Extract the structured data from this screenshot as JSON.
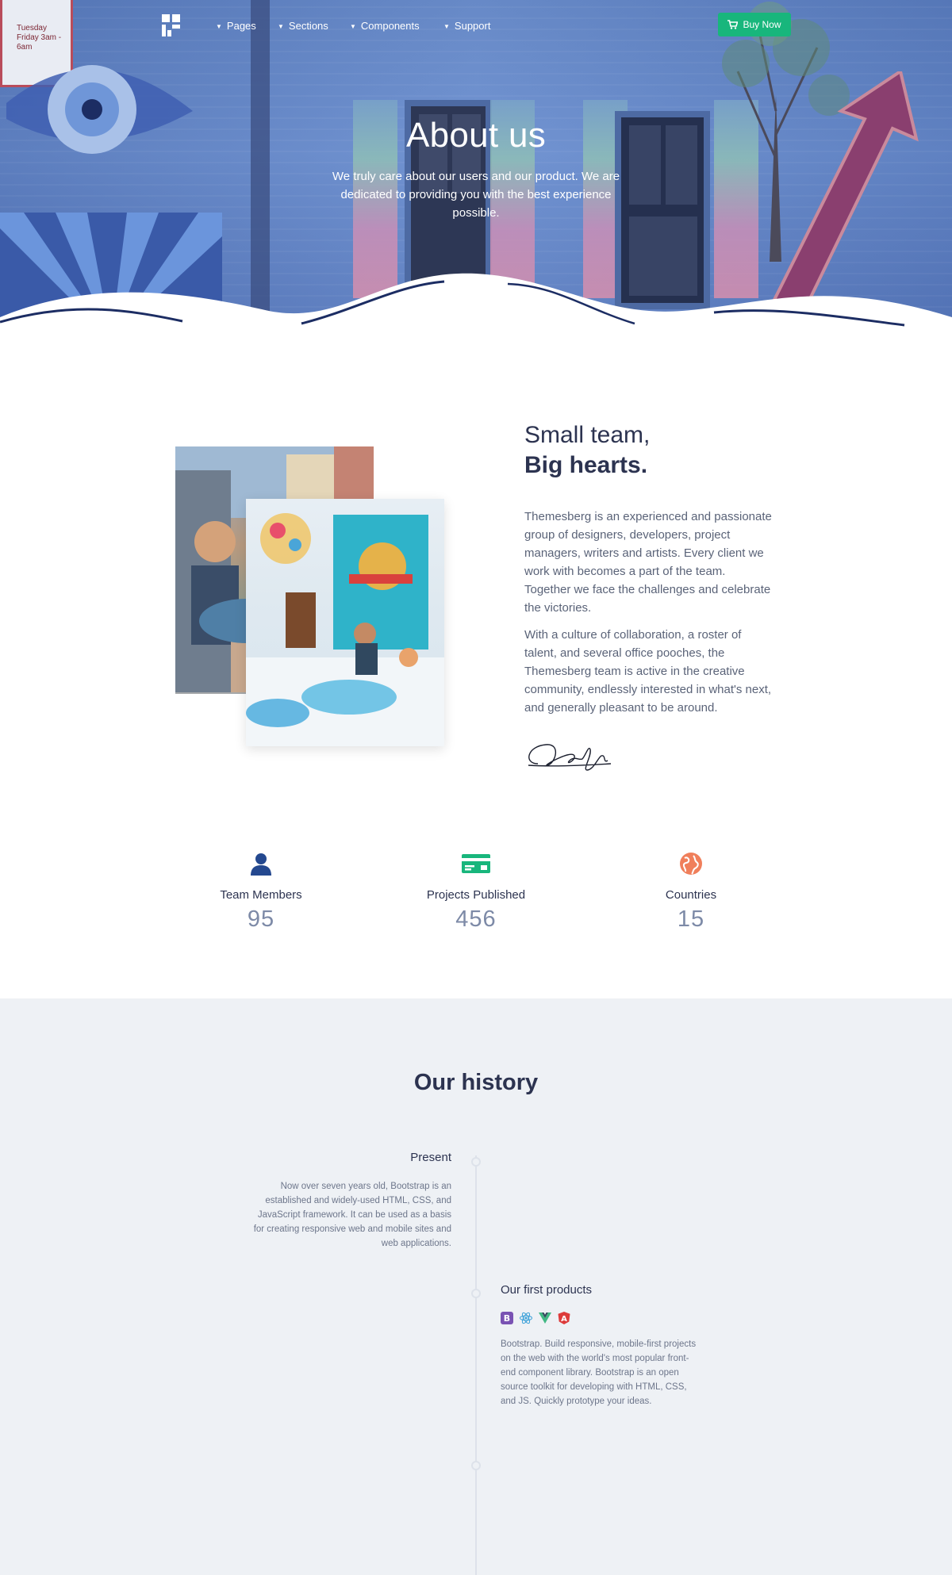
{
  "nav": {
    "items": [
      {
        "label": "Pages"
      },
      {
        "label": "Sections"
      },
      {
        "label": "Components"
      },
      {
        "label": "Support"
      }
    ],
    "buy_label": "Buy Now"
  },
  "hero": {
    "title": "About us",
    "subtitle": "We truly care about our users and our product. We are dedicated to providing you with the best experience possible.",
    "sign_text": "Tuesday Friday 3am - 6am"
  },
  "team": {
    "heading_light": "Small team,",
    "heading_bold": "Big hearts.",
    "paragraph1": "Themesberg is an experienced and passionate group of designers, developers, project managers, writers and artists. Every client we work with becomes a part of the team. Together we face the challenges and celebrate the victories.",
    "paragraph2": "With a culture of collaboration, a roster of talent, and several office pooches, the Themesberg team is active in the creative community, endlessly interested in what's next, and generally pleasant to be around."
  },
  "stats": [
    {
      "label": "Team Members",
      "value": "95",
      "icon": "user-icon",
      "color": "#24488f"
    },
    {
      "label": "Projects Published",
      "value": "456",
      "icon": "credit-card-icon",
      "color": "#18b67c"
    },
    {
      "label": "Countries",
      "value": "15",
      "icon": "globe-icon",
      "color": "#f07f5b"
    }
  ],
  "history": {
    "title_bold": "Our",
    "title_light": " history",
    "entries": [
      {
        "title": "Present",
        "text": "Now over seven years old, Bootstrap is an established and widely-used HTML, CSS, and JavaScript framework. It can be used as a basis for creating responsive web and mobile sites and web applications."
      },
      {
        "title": "Our first products",
        "text": "Bootstrap. Build responsive, mobile-first projects on the web with the world's most popular front-end component library. Bootstrap is an open source toolkit for developing with HTML, CSS, and JS. Quickly prototype your ideas.",
        "icons": [
          "bootstrap-icon",
          "react-icon",
          "vue-icon",
          "angular-icon"
        ]
      }
    ]
  },
  "colors": {
    "accent_green": "#18b67c",
    "navy": "#24488f",
    "heading": "#2c3350",
    "history_bg": "#eef1f5"
  }
}
